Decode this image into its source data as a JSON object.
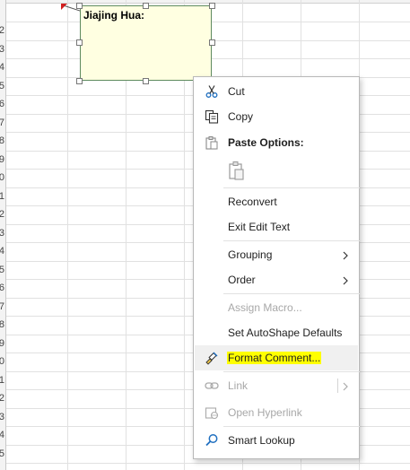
{
  "comment": {
    "author": "Jiajing Hua:"
  },
  "row_numbers": [
    "",
    "2",
    "3",
    "4",
    "5",
    "6",
    "7",
    "8",
    "9",
    "0",
    "1",
    "2",
    "3",
    "4",
    "5",
    "6",
    "7",
    "8",
    "9",
    "0",
    "1",
    "2",
    "3",
    "4",
    "5"
  ],
  "menu": {
    "cut": "Cut",
    "copy": "Copy",
    "paste_options": "Paste Options:",
    "reconvert": "Reconvert",
    "exit_edit_text": "Exit Edit Text",
    "grouping": "Grouping",
    "order": "Order",
    "assign_macro": "Assign Macro...",
    "set_autoshape_defaults": "Set AutoShape Defaults",
    "format_comment": "Format Comment...",
    "link": "Link",
    "open_hyperlink": "Open Hyperlink",
    "smart_lookup": "Smart Lookup"
  },
  "colors": {
    "comment_fill": "#ffffe1",
    "highlight": "#ffff00",
    "indicator_red": "#d21f1f",
    "icon_blue": "#1f6fc0"
  }
}
